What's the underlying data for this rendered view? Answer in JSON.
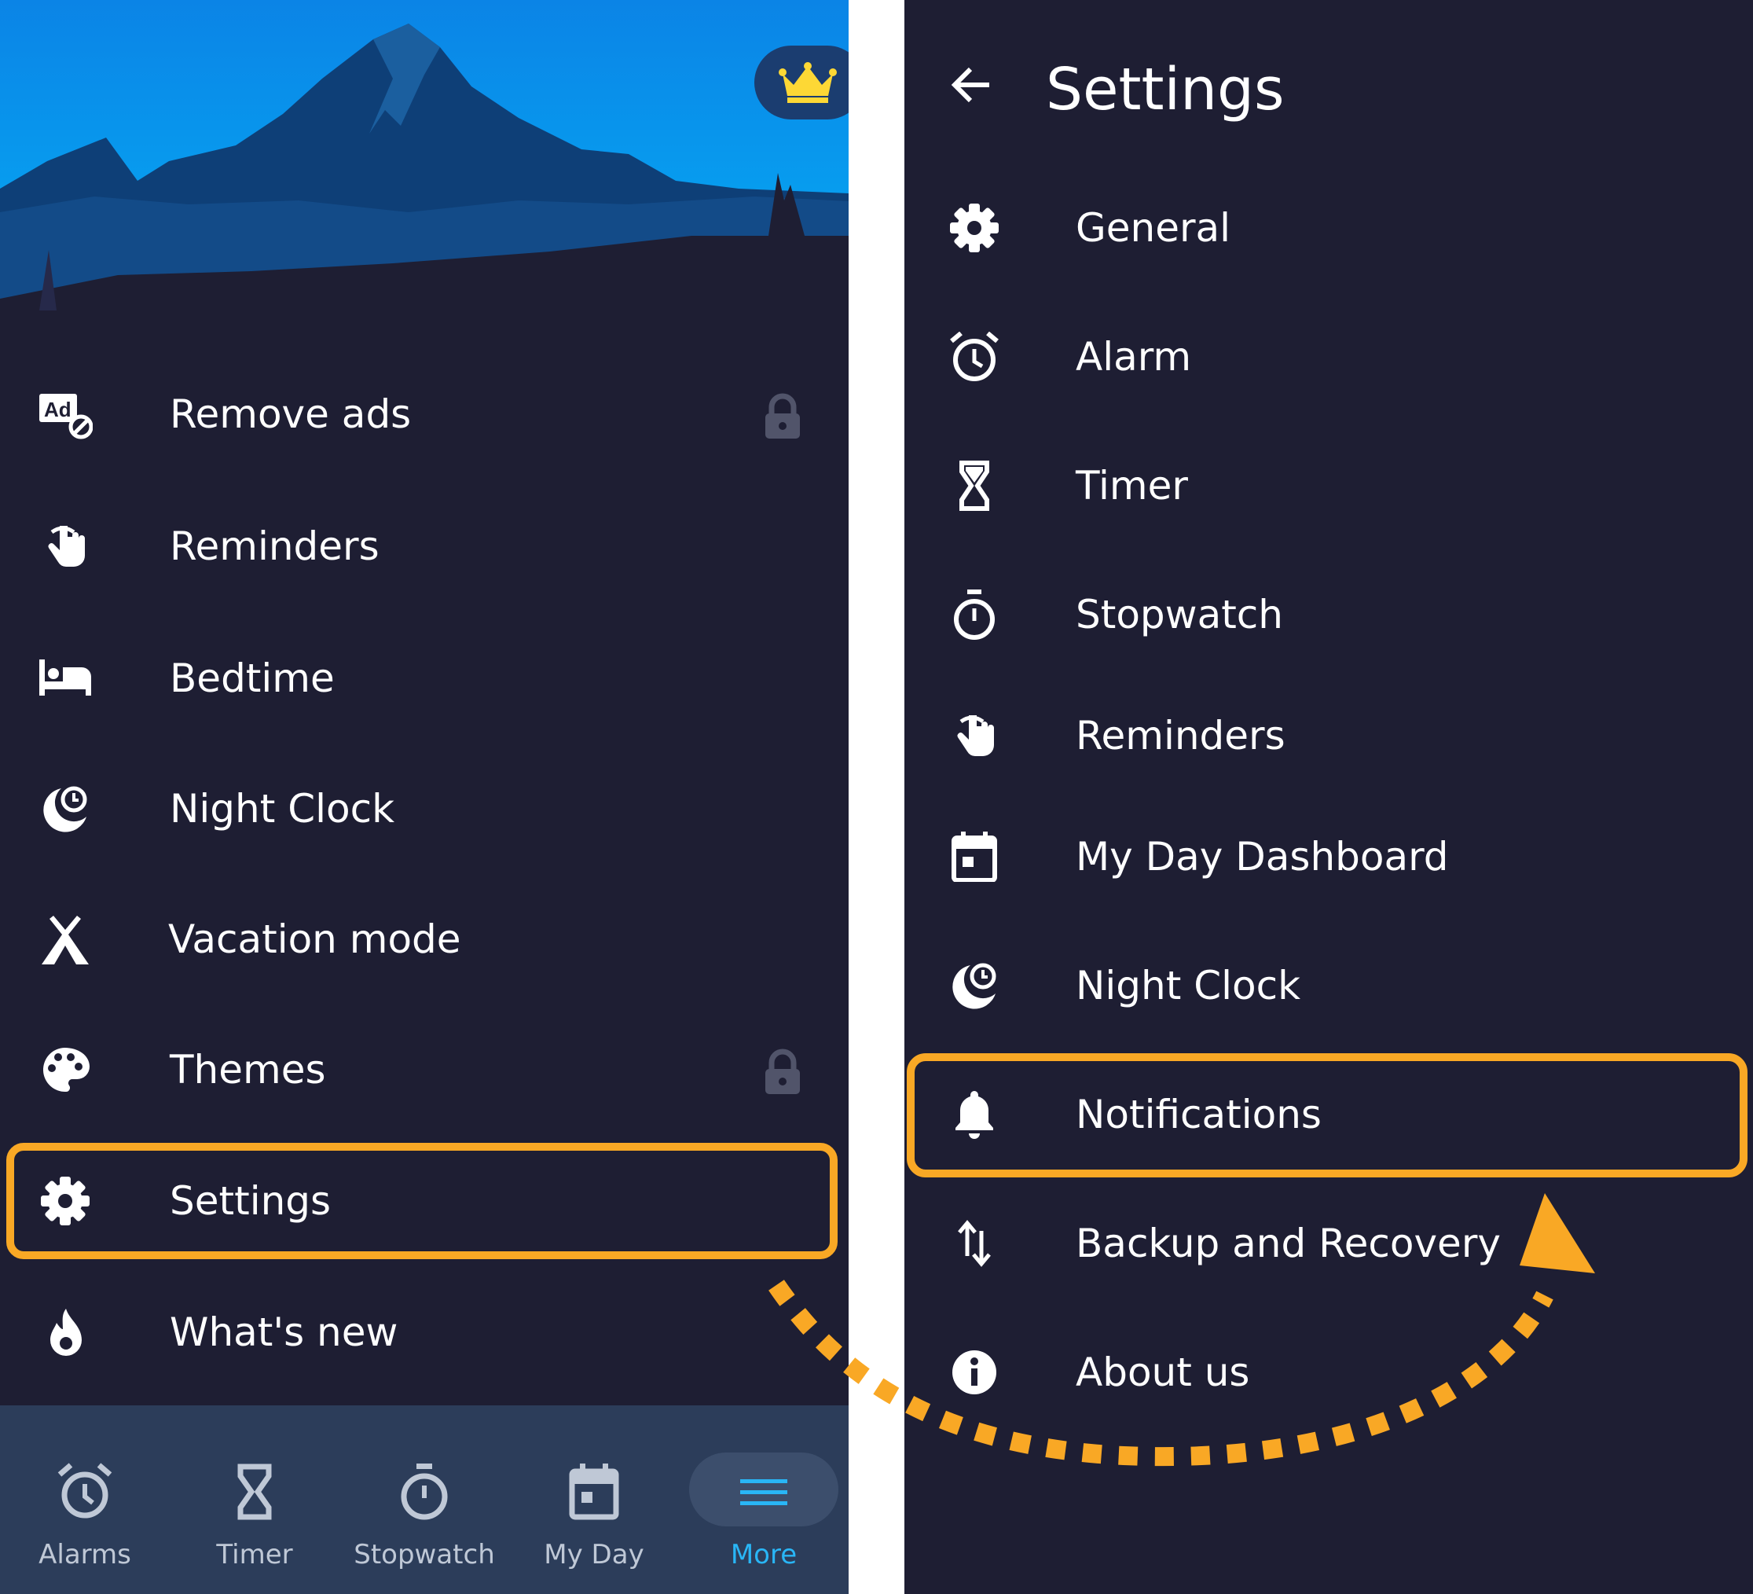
{
  "colors": {
    "panel_bg": "#1e1e33",
    "highlight": "#f9a825",
    "nav_bg": "#2c3d5a",
    "nav_active": "#29b6f6",
    "nav_inactive": "#bfc8d6",
    "lock": "#51546a",
    "crown": "#fdd835"
  },
  "left": {
    "premium_icon": "crown-icon",
    "menu": [
      {
        "label": "Remove ads",
        "icon": "ad-block-icon",
        "locked": true
      },
      {
        "label": "Reminders",
        "icon": "finger-string-icon",
        "locked": false
      },
      {
        "label": "Bedtime",
        "icon": "bed-icon",
        "locked": false
      },
      {
        "label": "Night Clock",
        "icon": "moon-clock-icon",
        "locked": false
      },
      {
        "label": "Vacation mode",
        "icon": "tent-icon",
        "locked": false
      },
      {
        "label": "Themes",
        "icon": "palette-icon",
        "locked": true
      },
      {
        "label": "Settings",
        "icon": "gear-icon",
        "locked": false,
        "highlighted": true
      },
      {
        "label": "What's new",
        "icon": "flame-icon",
        "locked": false
      }
    ],
    "bottom_nav": [
      {
        "label": "Alarms",
        "icon": "alarm-clock-icon",
        "active": false
      },
      {
        "label": "Timer",
        "icon": "hourglass-icon",
        "active": false
      },
      {
        "label": "Stopwatch",
        "icon": "stopwatch-icon",
        "active": false
      },
      {
        "label": "My Day",
        "icon": "calendar-icon",
        "active": false
      },
      {
        "label": "More",
        "icon": "menu-lines-icon",
        "active": true
      }
    ]
  },
  "right": {
    "title": "Settings",
    "back_icon": "arrow-left-icon",
    "items": [
      {
        "label": "General",
        "icon": "gear-icon"
      },
      {
        "label": "Alarm",
        "icon": "alarm-clock-icon"
      },
      {
        "label": "Timer",
        "icon": "hourglass-icon"
      },
      {
        "label": "Stopwatch",
        "icon": "stopwatch-icon"
      },
      {
        "label": "Reminders",
        "icon": "finger-string-icon"
      },
      {
        "label": "My Day Dashboard",
        "icon": "calendar-icon"
      },
      {
        "label": "Night Clock",
        "icon": "moon-clock-icon"
      },
      {
        "label": "Notifications",
        "icon": "bell-icon",
        "highlighted": true
      },
      {
        "label": "Backup and Recovery",
        "icon": "sync-arrows-icon"
      },
      {
        "label": "About us",
        "icon": "info-icon"
      }
    ]
  }
}
